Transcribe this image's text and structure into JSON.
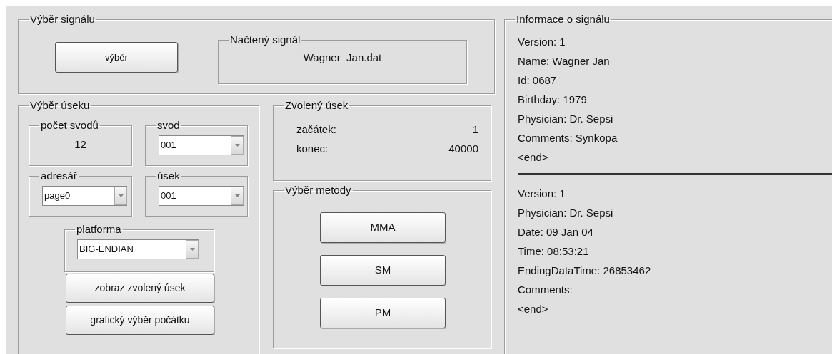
{
  "signal_selection": {
    "title": "Výběr signálu",
    "button": "výběr",
    "loaded_signal": {
      "title": "Načtený signál",
      "value": "Wagner_Jan.dat"
    }
  },
  "segment_selection": {
    "title": "Výběr úseku",
    "lead_count": {
      "title": "počet svodů",
      "value": "12"
    },
    "lead": {
      "title": "svod",
      "value": "001"
    },
    "directory": {
      "title": "adresář",
      "value": "page0"
    },
    "segment": {
      "title": "úsek",
      "value": "001"
    },
    "platform": {
      "title": "platforma",
      "value": "BIG-ENDIAN"
    },
    "buttons": [
      "zobraz zvolený úsek",
      "grafický výběr počátku"
    ]
  },
  "chosen_segment": {
    "title": "Zvolený úsek",
    "rows": [
      {
        "label": "začátek:",
        "value": "1"
      },
      {
        "label": "konec:",
        "value": "40000"
      }
    ]
  },
  "method_selection": {
    "title": "Výběr metody",
    "buttons": [
      "MMA",
      "SM",
      "PM"
    ]
  },
  "signal_info": {
    "title": "Informace o signálu",
    "blocks": [
      [
        "Version: 1",
        "Name: Wagner Jan",
        "Id: 0687",
        "Birthday: 1979",
        "Physician: Dr. Sepsi",
        "Comments: Synkopa",
        "<end>"
      ],
      [
        "Version: 1",
        "Physician: Dr. Sepsi",
        "Date: 09 Jan 04",
        "Time: 08:53:21",
        "EndingDataTime: 26853462",
        "Comments:",
        "<end>"
      ]
    ]
  }
}
